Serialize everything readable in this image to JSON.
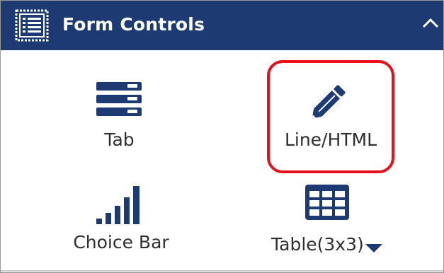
{
  "header": {
    "title": "Form Controls",
    "icon": "form-list-icon",
    "collapse_icon": "chevron-up-icon"
  },
  "items": [
    {
      "label": "Tab",
      "icon": "tab-stack-icon"
    },
    {
      "label": "Line/HTML",
      "icon": "pencil-icon",
      "highlighted": true
    },
    {
      "label": "Choice Bar",
      "icon": "bar-signal-icon"
    },
    {
      "label": "Table(3x3)",
      "icon": "table-grid-icon",
      "dropdown_icon": "caret-down-icon"
    }
  ],
  "colors": {
    "header_bg": "#1d3a73",
    "icon_blue": "#1d3a73",
    "highlight_border": "#e8101a",
    "label_text": "#2f2f2f"
  }
}
